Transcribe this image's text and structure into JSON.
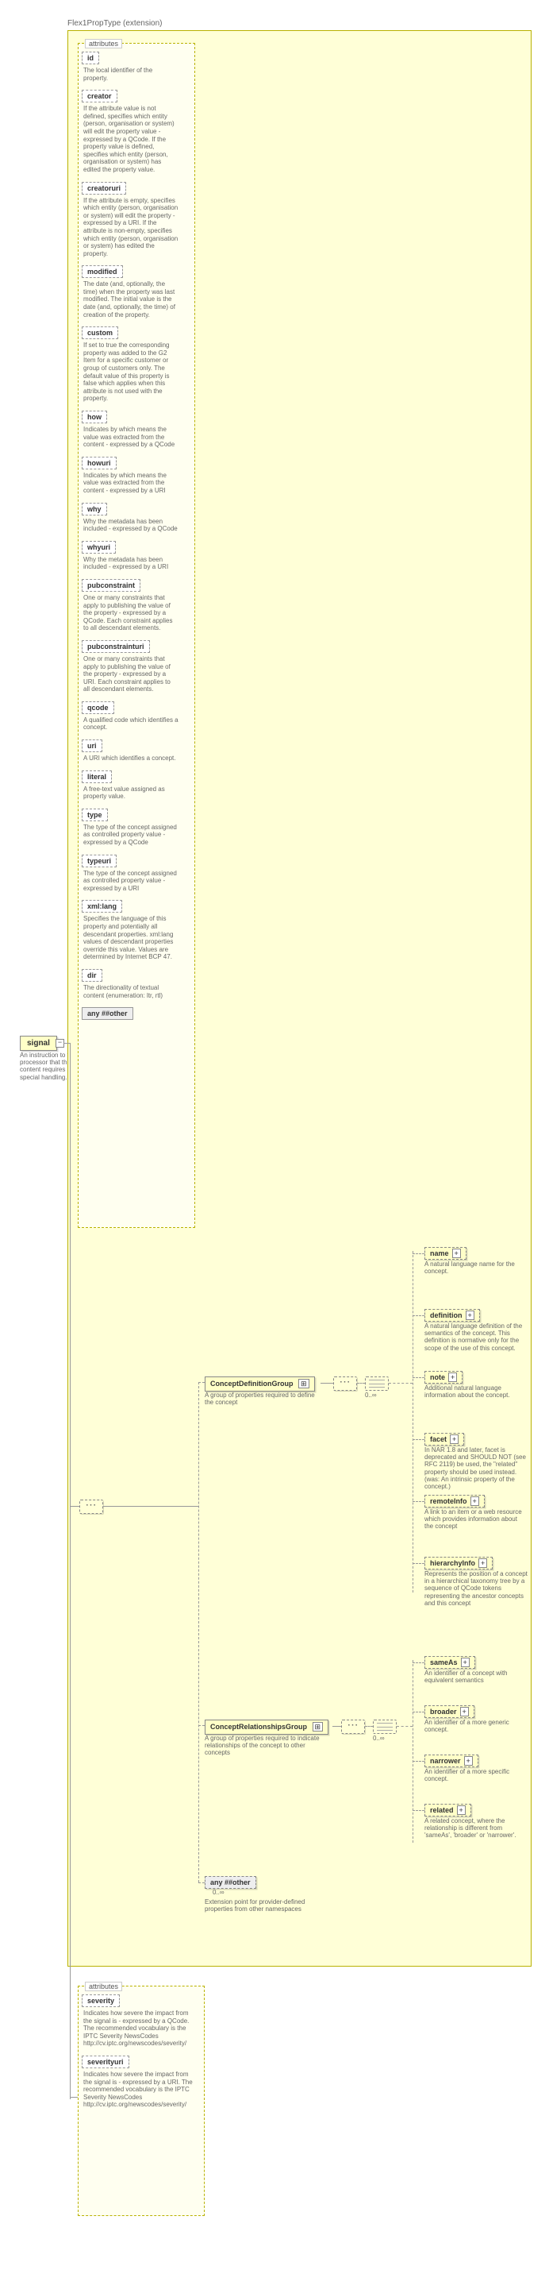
{
  "ext_title": "Flex1PropType (extension)",
  "root": {
    "name": "signal",
    "desc": "An instruction to the processor that the content requires special handling."
  },
  "attr_panel_title": "attributes",
  "attrs": [
    {
      "name": "id",
      "desc": "The local identifier of the property."
    },
    {
      "name": "creator",
      "desc": "If the attribute value is not defined, specifies which entity (person, organisation or system) will edit the property value - expressed by a QCode. If the property value is defined, specifies which entity (person, organisation or system) has edited the property value."
    },
    {
      "name": "creatoruri",
      "desc": "If the attribute is empty, specifies which entity (person, organisation or system) will edit the property - expressed by a URI. If the attribute is non-empty, specifies which entity (person, organisation or system) has edited the property."
    },
    {
      "name": "modified",
      "desc": "The date (and, optionally, the time) when the property was last modified. The initial value is the date (and, optionally, the time) of creation of the property."
    },
    {
      "name": "custom",
      "desc": "If set to true the corresponding property was added to the G2 Item for a specific customer or group of customers only. The default value of this property is false which applies when this attribute is not used with the property."
    },
    {
      "name": "how",
      "desc": "Indicates by which means the value was extracted from the content - expressed by a QCode"
    },
    {
      "name": "howuri",
      "desc": "Indicates by which means the value was extracted from the content - expressed by a URI"
    },
    {
      "name": "why",
      "desc": "Why the metadata has been included - expressed by a QCode"
    },
    {
      "name": "whyuri",
      "desc": "Why the metadata has been included - expressed by a URI"
    },
    {
      "name": "pubconstraint",
      "desc": "One or many constraints that apply to publishing the value of the property - expressed by a QCode. Each constraint applies to all descendant elements."
    },
    {
      "name": "pubconstrainturi",
      "desc": "One or many constraints that apply to publishing the value of the property - expressed by a URI. Each constraint applies to all descendant elements."
    },
    {
      "name": "qcode",
      "desc": "A qualified code which identifies a concept."
    },
    {
      "name": "uri",
      "desc": "A URI which identifies a concept."
    },
    {
      "name": "literal",
      "desc": "A free-text value assigned as property value."
    },
    {
      "name": "type",
      "desc": "The type of the concept assigned as controlled property value - expressed by a QCode"
    },
    {
      "name": "typeuri",
      "desc": "The type of the concept assigned as controlled property value - expressed by a URI"
    },
    {
      "name": "xml:lang",
      "desc": "Specifies the language of this property and potentially all descendant properties. xml:lang values of descendant properties override this value. Values are determined by Internet BCP 47."
    },
    {
      "name": "dir",
      "desc": "The directionality of textual content (enumeration: ltr, rtl)"
    }
  ],
  "attr_any_label": "any ##other",
  "cdg": {
    "label": "ConceptDefinitionGroup",
    "altbg": "⊞",
    "desc": "A group of properties required to define the concept",
    "card": "0..∞"
  },
  "crg": {
    "label": "ConceptRelationshipsGroup",
    "altbg": "⊞",
    "desc": "A group of properties required to indicate relationships of the concept to other concepts",
    "card": "0..∞"
  },
  "any_other": {
    "label": "any ##other",
    "card": "0..∞",
    "desc": "Extension point for provider-defined properties from other namespaces"
  },
  "def_children": [
    {
      "name": "name",
      "desc": "A natural language name for the concept."
    },
    {
      "name": "definition",
      "desc": "A natural language definition of the semantics of the concept. This definition is normative only for the scope of the use of this concept."
    },
    {
      "name": "note",
      "desc": "Additional natural language information about the concept."
    },
    {
      "name": "facet",
      "desc": "In NAR 1.8 and later, facet is deprecated and SHOULD NOT (see RFC 2119) be used, the \"related\" property should be used instead. (was: An intrinsic property of the concept.)"
    },
    {
      "name": "remoteInfo",
      "desc": "A link to an item or a web resource which provides information about the concept"
    },
    {
      "name": "hierarchyInfo",
      "desc": "Represents the position of a concept in a hierarchical taxonomy tree by a sequence of QCode tokens representing the ancestor concepts and this concept"
    }
  ],
  "rel_children": [
    {
      "name": "sameAs",
      "desc": "An identifier of a concept with equivalent semantics"
    },
    {
      "name": "broader",
      "desc": "An identifier of a more generic concept."
    },
    {
      "name": "narrower",
      "desc": "An identifier of a more specific concept."
    },
    {
      "name": "related",
      "desc": "A related concept, where the relationship is different from 'sameAs', 'broader' or 'narrower'."
    }
  ],
  "severity_panel_title": "attributes",
  "severity_attrs": [
    {
      "name": "severity",
      "desc": "Indicates how severe the impact from the signal is - expressed by a QCode. The recommended vocabulary is the IPTC Severity NewsCodes http://cv.iptc.org/newscodes/severity/"
    },
    {
      "name": "severityuri",
      "desc": "Indicates how severe the impact from the signal is - expressed by a URI. The recommended vocabulary is the IPTC Severity NewsCodes http://cv.iptc.org/newscodes/severity/"
    }
  ]
}
